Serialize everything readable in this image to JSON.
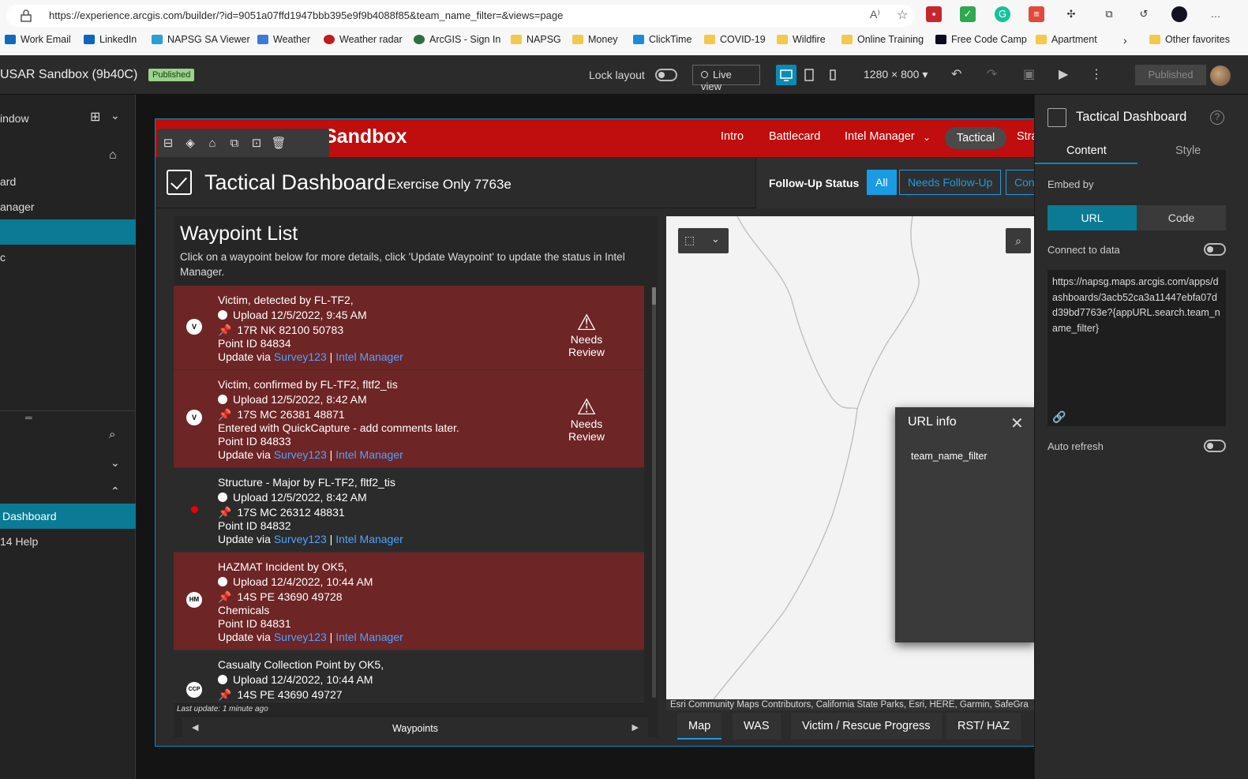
{
  "browser": {
    "url": "https://experience.arcgis.com/builder/?id=9051a07ffd1947bbb395e9f9b4088f85&team_name_filter=&views=page",
    "bookmarks": [
      "Work Email",
      "LinkedIn",
      "NAPSG SA Viewer",
      "Weather",
      "Weather radar",
      "ArcGIS - Sign In",
      "NAPSG",
      "Money",
      "ClickTime",
      "COVID-19",
      "Wildfire",
      "Online Training",
      "Free Code Camp",
      "Apartment",
      "Other favorites"
    ]
  },
  "builder": {
    "app_title": "USAR Sandbox (9b40C)",
    "published_badge": "Published",
    "lock_layout": "Lock layout",
    "live_view": "Live view",
    "resolution": "1280 × 800",
    "published_button": "Published"
  },
  "left_panel": {
    "items": [
      "indow",
      "ard",
      "anager",
      "c"
    ],
    "bottom_items": [
      "Dashboard",
      "14 Help"
    ]
  },
  "app": {
    "header_title": "Sandbox",
    "nav": [
      "Intro",
      "Battlecard",
      "Intel Manager",
      "Tactical",
      "Stra"
    ],
    "dashboard_title": "Tactical Dashboard",
    "dashboard_sub": "Exercise Only 7763e",
    "follow_up_label": "Follow-Up Status",
    "follow_up_buttons": [
      "All",
      "Needs Follow-Up",
      "Con"
    ],
    "waypoint_list": {
      "title": "Waypoint List",
      "description": "Click on a waypoint below for more details, click 'Update Waypoint' to update the status in Intel Manager.",
      "rows": [
        {
          "symbol": "V",
          "lines": [
            "Victim, detected by FL-TF2,",
            "Upload 12/5/2022, 9:45 AM",
            "17R NK 82100 50783",
            "Point ID 84834"
          ],
          "review": "Needs Review"
        },
        {
          "symbol": "V",
          "lines": [
            "Victim, confirmed by FL-TF2, fltf2_tis",
            "Upload 12/5/2022, 8:42 AM",
            "17S MC 26381 48871",
            "Entered with QuickCapture - add comments later.",
            "Point ID 84833"
          ],
          "review": "Needs Review"
        },
        {
          "symbol": "",
          "lines": [
            "Structure - Major by FL-TF2, fltf2_tis",
            "Upload 12/5/2022, 8:42 AM",
            "17S MC 26312 48831",
            "Point ID 84832"
          ],
          "review": ""
        },
        {
          "symbol": "HM",
          "lines": [
            "HAZMAT Incident by OK5,",
            "Upload 12/4/2022, 10:44 AM",
            "14S PE 43690 49728",
            "Chemicals",
            "Point ID 84831"
          ],
          "review": ""
        },
        {
          "symbol": "CCP",
          "lines": [
            "Casualty Collection Point by OK5,",
            "Upload 12/4/2022, 10:44 AM",
            "14S PE 43690 49727"
          ],
          "review": ""
        }
      ],
      "update_via": "Update via",
      "link_survey": "Survey123",
      "sep": "|",
      "link_intel": "Intel Manager",
      "last_update": "Last update: 1 minute ago",
      "footer_label": "Waypoints"
    },
    "map": {
      "attribution": "Esri Community Maps Contributors, California State Parks, Esri, HERE, Garmin, SafeGra",
      "tabs": [
        "Map",
        "WAS",
        "Victim / Rescue Progress",
        "RST/ HAZ"
      ]
    },
    "url_info": {
      "title": "URL info",
      "param": "team_name_filter"
    }
  },
  "right_panel": {
    "title": "Tactical Dashboard",
    "tab_content": "Content",
    "tab_style": "Style",
    "embed_by": "Embed by",
    "embed_url": "URL",
    "embed_code": "Code",
    "connect_to_data": "Connect to data",
    "url_value": "https://napsg.maps.arcgis.com/apps/dashboards/3acb52ca3a11447ebfa07dd39bd7763e?{appURL.search.team_name_filter}",
    "auto_refresh": "Auto refresh"
  },
  "colors": {
    "accent": "#0a8bb5",
    "header_red": "#c00d0d",
    "review_red": "#6e2525",
    "link_blue": "#4da3ff"
  }
}
